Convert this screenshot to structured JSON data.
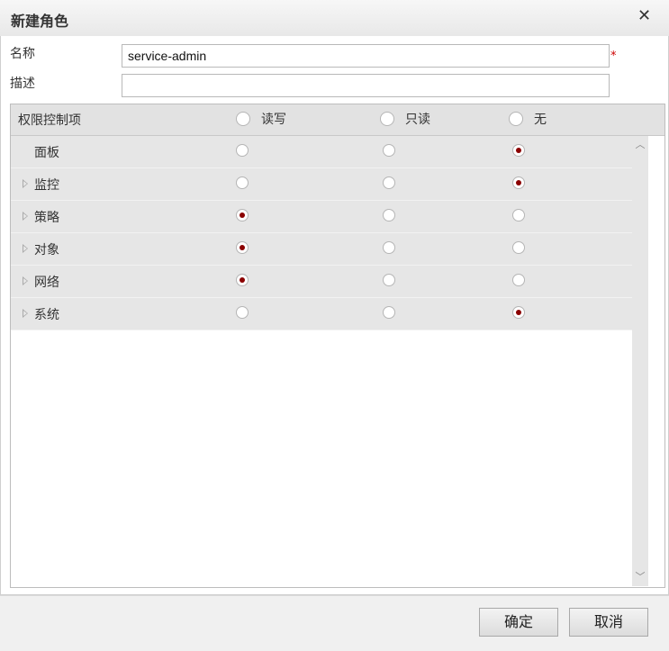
{
  "dialog": {
    "title": "新建角色",
    "close_glyph": "✕"
  },
  "form": {
    "name_label": "名称",
    "name_value": "service-admin",
    "required_mark": "*",
    "desc_label": "描述",
    "desc_value": ""
  },
  "permissions": {
    "header_label": "权限控制项",
    "options": [
      "读写",
      "只读",
      "无"
    ],
    "rows": [
      {
        "label": "面板",
        "expandable": false,
        "selected": "无"
      },
      {
        "label": "监控",
        "expandable": true,
        "selected": "无"
      },
      {
        "label": "策略",
        "expandable": true,
        "selected": "读写"
      },
      {
        "label": "对象",
        "expandable": true,
        "selected": "读写"
      },
      {
        "label": "网络",
        "expandable": true,
        "selected": "读写"
      },
      {
        "label": "系统",
        "expandable": true,
        "selected": "无"
      }
    ],
    "scroll_up_glyph": "︿",
    "scroll_down_glyph": "﹀"
  },
  "footer": {
    "ok_label": "确定",
    "cancel_label": "取消"
  },
  "colors": {
    "radio_checked": "#8b0000",
    "required": "#cc0000"
  }
}
